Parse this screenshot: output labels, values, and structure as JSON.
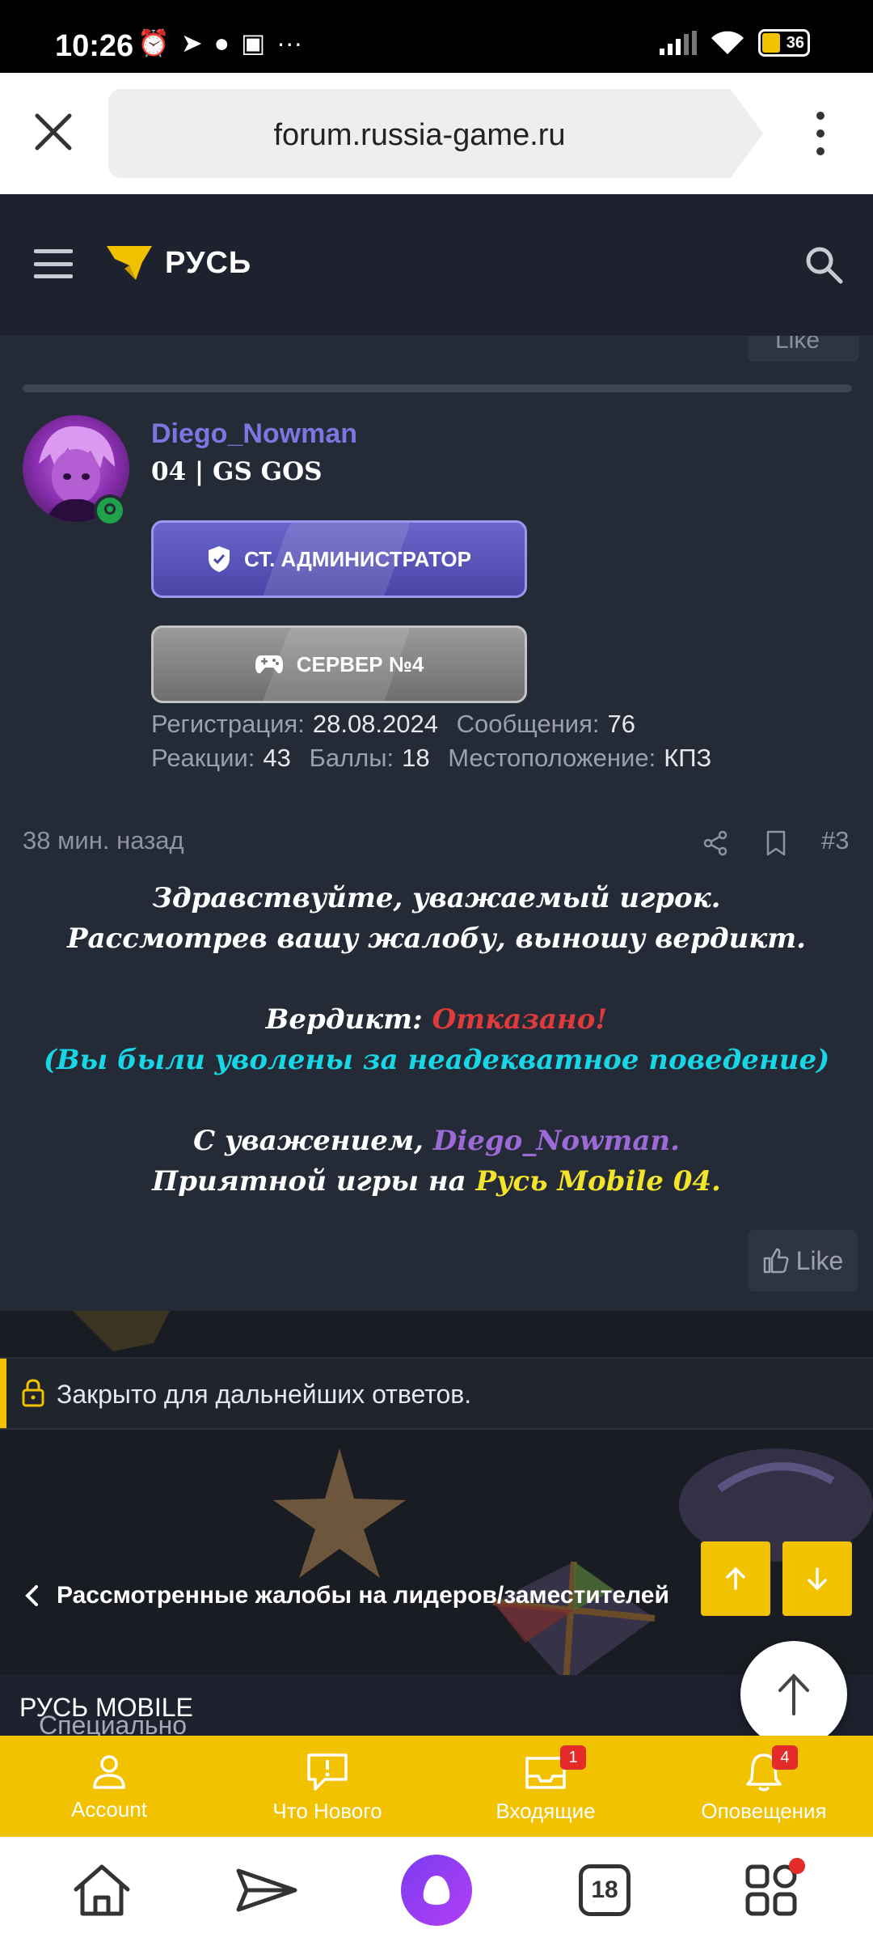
{
  "status_bar": {
    "time": "10:26",
    "battery": "36"
  },
  "browser": {
    "url": "forum.russia-game.ru",
    "tabs_count": "18"
  },
  "site": {
    "logo_text": "РУСЬ"
  },
  "prev_post": {
    "like_label": "Like"
  },
  "post": {
    "author": "Diego_Nowman",
    "user_title": "04 | GS GOS",
    "banner_role": "СТ. АДМИНИСТРАТОР",
    "banner_server": "СЕРВЕР №4",
    "stats": {
      "reg_label": "Регистрация:",
      "reg_value": "28.08.2024",
      "msg_label": "Сообщения:",
      "msg_value": "76",
      "react_label": "Реакции:",
      "react_value": "43",
      "points_label": "Баллы:",
      "points_value": "18",
      "loc_label": "Местоположение:",
      "loc_value": "КПЗ"
    },
    "time": "38 мин. назад",
    "number": "#3",
    "message": {
      "line1": "Здравствуйте, уважаемый игрок.",
      "line2": "Рассмотрев вашу жалобу, выношу вердикт.",
      "verdict_label": "Вердикт: ",
      "verdict_value": "Отказано!",
      "reason": "(Вы были уволены за неадекватное поведение)",
      "regards": "С уважением, ",
      "regards_name": "Diego_Nowman.",
      "enjoy": "Приятной игры на ",
      "enjoy_server": "Русь Mobile 04."
    },
    "like_label": "Like"
  },
  "thread_closed": "Закрыто для дальнейших ответов.",
  "breadcrumb": "Рассмотренные жалобы на лидеров/заместителей",
  "footer": {
    "prefix": "Специально для ",
    "brand": "РУСЬ MOBILE"
  },
  "tabbar": [
    {
      "label": "Account",
      "badge": ""
    },
    {
      "label": "Что Нового",
      "badge": ""
    },
    {
      "label": "Входящие",
      "badge": "1"
    },
    {
      "label": "Оповещения",
      "badge": "4"
    }
  ],
  "colors": {
    "accent": "#f2c200",
    "username": "#7b77e0",
    "verdict": "#e03b3b",
    "reason": "#17d7e6"
  }
}
